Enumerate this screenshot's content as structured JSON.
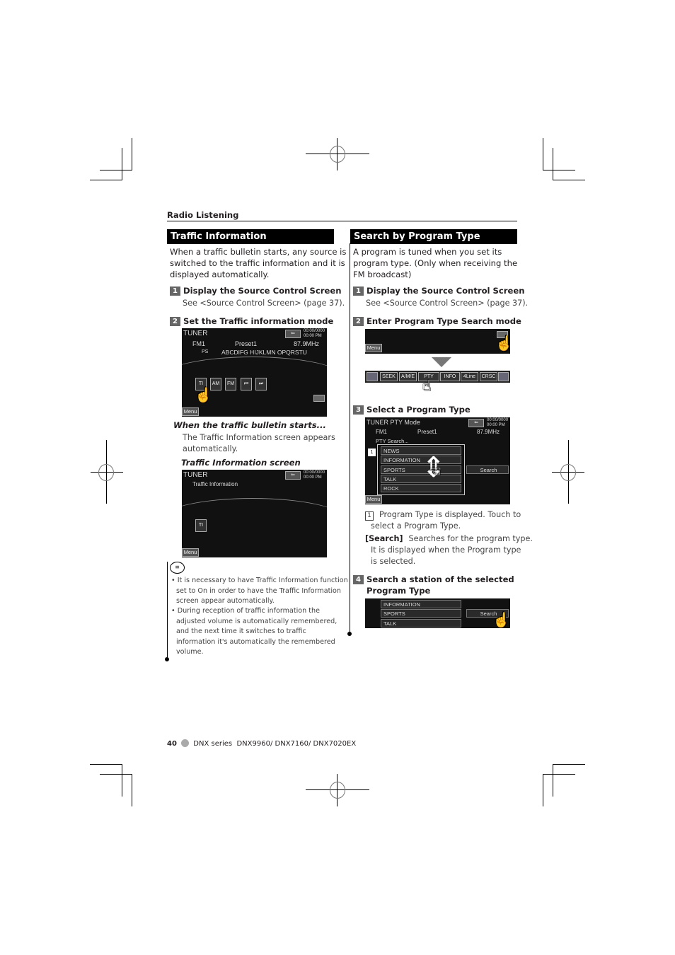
{
  "header": {
    "section": "Radio Listening"
  },
  "left": {
    "title": "Traffic Information",
    "intro": [
      "When a traffic bulletin starts, any source is",
      "switched to the traffic information and it is",
      "displayed automatically."
    ],
    "steps": [
      {
        "num": "1",
        "label": "Display the Source Control Screen",
        "detail": "See <Source Control Screen> (page 37)."
      },
      {
        "num": "2",
        "label": "Set the Traffic information mode"
      }
    ],
    "screen1": {
      "source": "TUNER",
      "band": "FM1",
      "preset": "Preset1",
      "freq": "87.9MHz",
      "ps_label": "PS",
      "ps_text": "ABCDIFG HIJKLMN OPQRSTU",
      "clock": [
        "00:00/0000",
        "00:00 PM"
      ],
      "buttons": [
        "TI",
        "AM",
        "FM",
        "⏮",
        "⏭"
      ],
      "menu": "Menu"
    },
    "when_head": "When the traffic bulletin starts...",
    "when_text": [
      "The Traffic Information screen appears",
      "automatically."
    ],
    "screen2_head": "Traffic Information screen",
    "screen2": {
      "source": "TUNER",
      "subtitle": "Traffic Information",
      "clock": [
        "00:00/0000",
        "00:00 PM"
      ],
      "button": "TI",
      "menu": "Menu"
    },
    "notes": [
      [
        "It is necessary to have Traffic Information function",
        "set to On in order to have the Traffic Information",
        "screen appear automatically."
      ],
      [
        "During reception of traffic information the",
        "adjusted volume is automatically remembered,",
        "and the next time it switches to traffic",
        "information it's automatically the remembered",
        "volume."
      ]
    ]
  },
  "right": {
    "title": "Search by Program Type",
    "intro": [
      "A program is tuned when you set its",
      "program type. (Only when receiving the",
      "FM broadcast)"
    ],
    "steps": [
      {
        "num": "1",
        "label": "Display the Source Control Screen",
        "detail": "See <Source Control Screen> (page 37)."
      },
      {
        "num": "2",
        "label": "Enter Program Type Search mode"
      },
      {
        "num": "3",
        "label": "Select a Program Type"
      },
      {
        "num": "4",
        "label": "Search a station of the selected",
        "label2": "Program Type"
      }
    ],
    "menu": "Menu",
    "control_bar": [
      "SEEK",
      "A/M/E",
      "PTY",
      "INFO",
      "4Line",
      "CRSC"
    ],
    "pty_screen": {
      "title": "TUNER PTY Mode",
      "band": "FM1",
      "preset": "Preset1",
      "freq": "87.9MHz",
      "status": "PTY Search...",
      "clock": [
        "00:00/0000",
        "00:00 PM"
      ],
      "callout": "1",
      "items": [
        "NEWS",
        "INFORMATION",
        "SPORTS",
        "TALK",
        "ROCK"
      ],
      "search": "Search",
      "menu": "Menu"
    },
    "legend": [
      {
        "key": "1",
        "text": [
          "Program Type is displayed. Touch to",
          "select a Program Type."
        ]
      },
      {
        "key": "[Search]",
        "text": [
          "Searches for the program type.",
          "It is displayed when the Program type",
          "is selected."
        ]
      }
    ],
    "search_screen": {
      "items": [
        "INFORMATION",
        "SPORTS",
        "TALK"
      ],
      "search": "Search"
    }
  },
  "footer": {
    "page": "40",
    "series": "DNX series",
    "models": "DNX9960/ DNX7160/ DNX7020EX"
  }
}
